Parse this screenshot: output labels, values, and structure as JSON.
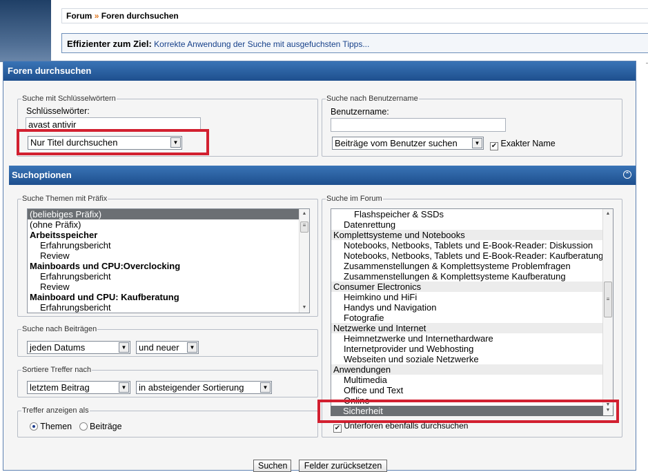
{
  "breadcrumb": {
    "root": "Forum",
    "separator": "»",
    "current": "Foren durchsuchen"
  },
  "tip": {
    "label": "Effizienter zum Ziel:",
    "link": "Korrekte Anwendung der Suche mit ausgefuchsten Tipps..."
  },
  "panel": {
    "title": "Foren durchsuchen"
  },
  "keywords": {
    "legend": "Suche mit Schlüsselwörtern",
    "label": "Schlüsselwörter:",
    "value": "avast antivir",
    "mode": "Nur Titel durchsuchen"
  },
  "user": {
    "legend": "Suche nach Benutzername",
    "label": "Benutzername:",
    "value": "",
    "mode": "Beiträge vom Benutzer suchen",
    "exact_label": "Exakter Name",
    "exact_checked": true
  },
  "options": {
    "title": "Suchoptionen"
  },
  "prefix": {
    "legend": "Suche Themen mit Präfix",
    "items": [
      {
        "text": "(beliebiges Präfix)",
        "level": 0,
        "bold": false,
        "selected": true
      },
      {
        "text": "(ohne Präfix)",
        "level": 0,
        "bold": false,
        "selected": false
      },
      {
        "text": "Arbeitsspeicher",
        "level": 0,
        "bold": true,
        "selected": false
      },
      {
        "text": "Erfahrungsbericht",
        "level": 1,
        "bold": false,
        "selected": false
      },
      {
        "text": "Review",
        "level": 1,
        "bold": false,
        "selected": false
      },
      {
        "text": "Mainboards und CPU:Overclocking",
        "level": 0,
        "bold": true,
        "selected": false
      },
      {
        "text": "Erfahrungsbericht",
        "level": 1,
        "bold": false,
        "selected": false
      },
      {
        "text": "Review",
        "level": 1,
        "bold": false,
        "selected": false
      },
      {
        "text": "Mainboard und CPU: Kaufberatung",
        "level": 0,
        "bold": true,
        "selected": false
      },
      {
        "text": "Erfahrungsbericht",
        "level": 1,
        "bold": false,
        "selected": false
      }
    ]
  },
  "posts": {
    "legend": "Suche nach Beiträgen",
    "date": "jeden Datums",
    "direction": "und neuer"
  },
  "sort": {
    "legend": "Sortiere Treffer nach",
    "field": "letztem Beitrag",
    "order": "in absteigender Sortierung"
  },
  "display": {
    "legend": "Treffer anzeigen als",
    "opt1": "Themen",
    "opt2": "Beiträge",
    "selected": "Themen"
  },
  "forum": {
    "legend": "Suche im Forum",
    "items": [
      {
        "text": "Flashspeicher & SSDs",
        "level": 2,
        "alt": false
      },
      {
        "text": "Datenrettung",
        "level": 1,
        "alt": false
      },
      {
        "text": "Komplettsysteme und Notebooks",
        "level": 0,
        "alt": true
      },
      {
        "text": "Notebooks, Netbooks, Tablets und E-Book-Reader: Diskussion",
        "level": 1,
        "alt": false
      },
      {
        "text": "Notebooks, Netbooks, Tablets und E-Book-Reader: Kaufberatung",
        "level": 1,
        "alt": false
      },
      {
        "text": "Zusammenstellungen & Komplettsysteme Problemfragen",
        "level": 1,
        "alt": false
      },
      {
        "text": "Zusammenstellungen & Komplettsysteme Kaufberatung",
        "level": 1,
        "alt": false
      },
      {
        "text": "Consumer Electronics",
        "level": 0,
        "alt": true
      },
      {
        "text": "Heimkino und HiFi",
        "level": 1,
        "alt": false
      },
      {
        "text": "Handys und Navigation",
        "level": 1,
        "alt": false
      },
      {
        "text": "Fotografie",
        "level": 1,
        "alt": false
      },
      {
        "text": "Netzwerke und Internet",
        "level": 0,
        "alt": true
      },
      {
        "text": "Heimnetzwerke und Internethardware",
        "level": 1,
        "alt": false
      },
      {
        "text": "Internetprovider und Webhosting",
        "level": 1,
        "alt": false
      },
      {
        "text": "Webseiten und soziale Netzwerke",
        "level": 1,
        "alt": false
      },
      {
        "text": "Anwendungen",
        "level": 0,
        "alt": true
      },
      {
        "text": "Multimedia",
        "level": 1,
        "alt": false
      },
      {
        "text": "Office und Text",
        "level": 1,
        "alt": false
      },
      {
        "text": "Online",
        "level": 1,
        "alt": false
      }
    ],
    "selected": "Sicherheit",
    "subforums_label": "Unterforen ebenfalls durchsuchen",
    "subforums_checked": true
  },
  "buttons": {
    "search": "Suchen",
    "reset": "Felder zurücksetzen"
  },
  "colors": {
    "header": "#1e4f8e",
    "highlight": "#d22030"
  }
}
